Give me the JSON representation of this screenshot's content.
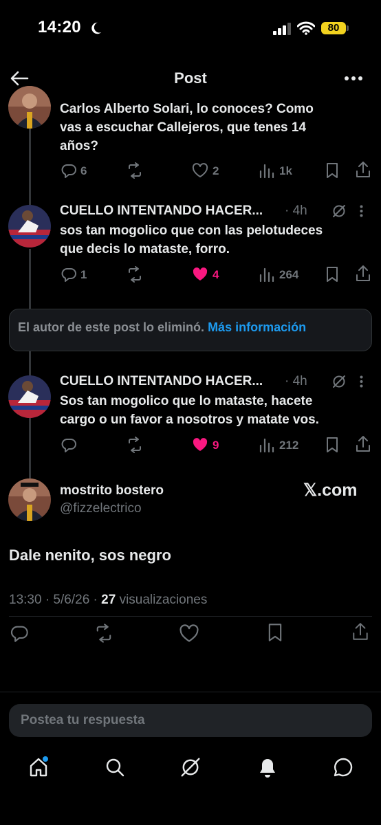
{
  "status_bar": {
    "time": "14:20",
    "battery": "80"
  },
  "header": {
    "title": "Post"
  },
  "reply1": {
    "text_line1": "Carlos Alberto Solari, lo conoces? Como",
    "text_line2": "vas a escuchar Callejeros, que tenes 14",
    "text_line3": "años?",
    "replies": "6",
    "likes": "2",
    "views": "1k"
  },
  "reply2": {
    "name": "CUELLO INTENTANDO HACER...",
    "time": "· 4h",
    "text_line1": "sos tan mogolico que con las pelotudeces",
    "text_line2": "que decis lo mataste, forro.",
    "replies": "1",
    "likes": "4",
    "views": "264"
  },
  "deleted_notice": {
    "text": "El autor de este post lo eliminó.",
    "link": "Más información"
  },
  "reply3": {
    "name": "CUELLO INTENTANDO HACER...",
    "time": "· 4h",
    "text_line1": "Sos tan mogolico que lo mataste, hacete",
    "text_line2": "cargo o un favor a nosotros y matate vos.",
    "likes": "9",
    "views": "212"
  },
  "main_post": {
    "name": "mostrito bostero",
    "handle": "@fizzelectrico",
    "source": "𝕏.com",
    "text": "Dale nenito, sos negro",
    "time": "13:30",
    "date": "· 5/6/26 ·",
    "views_count": "27",
    "views_label": "visualizaciones"
  },
  "reply_input": {
    "placeholder": "Postea tu respuesta"
  },
  "colors": {
    "like": "#f91880",
    "link": "#1d9bf0",
    "muted": "#71767b",
    "battery": "#f2d21f"
  },
  "icons": [
    "back-arrow-icon",
    "more-icon",
    "reply-icon",
    "repost-icon",
    "like-icon",
    "views-icon",
    "bookmark-icon",
    "share-icon",
    "grok-icon",
    "home-icon",
    "search-icon",
    "notifications-icon",
    "messages-icon"
  ]
}
